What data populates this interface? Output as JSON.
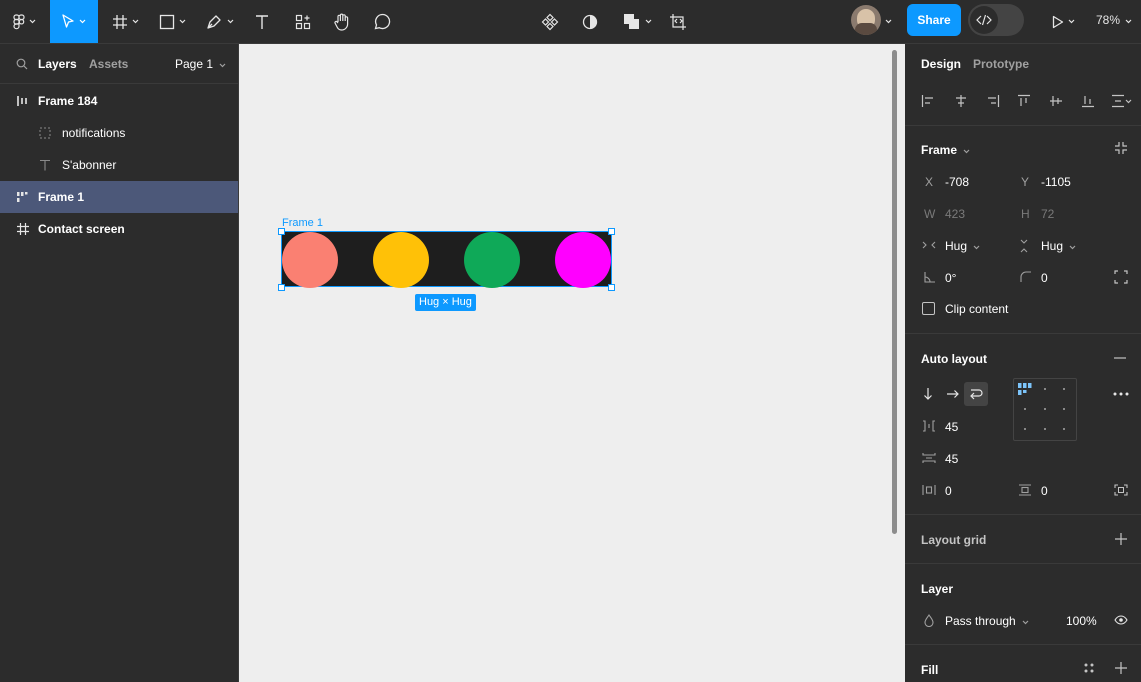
{
  "toolbar": {
    "share_label": "Share",
    "zoom": "78%"
  },
  "left_panel": {
    "tabs": [
      "Layers",
      "Assets"
    ],
    "page": "Page 1",
    "layers": [
      {
        "label": "Frame 184",
        "icon": "vertical-layout-icon",
        "indent": 0
      },
      {
        "label": "notifications",
        "icon": "dashed-frame-icon",
        "indent": 1
      },
      {
        "label": "S'abonner",
        "icon": "text-icon",
        "indent": 1
      },
      {
        "label": "Frame 1",
        "icon": "wrap-layout-icon",
        "indent": 0,
        "selected": true
      },
      {
        "label": "Contact screen",
        "icon": "frame-icon",
        "indent": 0
      }
    ]
  },
  "canvas": {
    "frame_label": "Frame 1",
    "size_badge": "Hug × Hug",
    "circle_colors": [
      "#fa8072",
      "#ffc107",
      "#0fa958",
      "#ff00ff"
    ]
  },
  "right_panel": {
    "tabs": [
      "Design",
      "Prototype"
    ],
    "frame": {
      "title": "Frame",
      "x_label": "X",
      "x": "-708",
      "y_label": "Y",
      "y": "-1105",
      "w_label": "W",
      "w": "423",
      "h_label": "H",
      "h": "72",
      "h_sizing": "Hug",
      "v_sizing": "Hug",
      "rotation": "0°",
      "radius": "0",
      "clip_label": "Clip content"
    },
    "auto_layout": {
      "title": "Auto layout",
      "gap_h": "45",
      "gap_v": "45",
      "pad_h": "0",
      "pad_v": "0"
    },
    "layout_grid": {
      "title": "Layout grid"
    },
    "layer": {
      "title": "Layer",
      "blend": "Pass through",
      "opacity": "100%"
    },
    "fill": {
      "title": "Fill"
    }
  }
}
